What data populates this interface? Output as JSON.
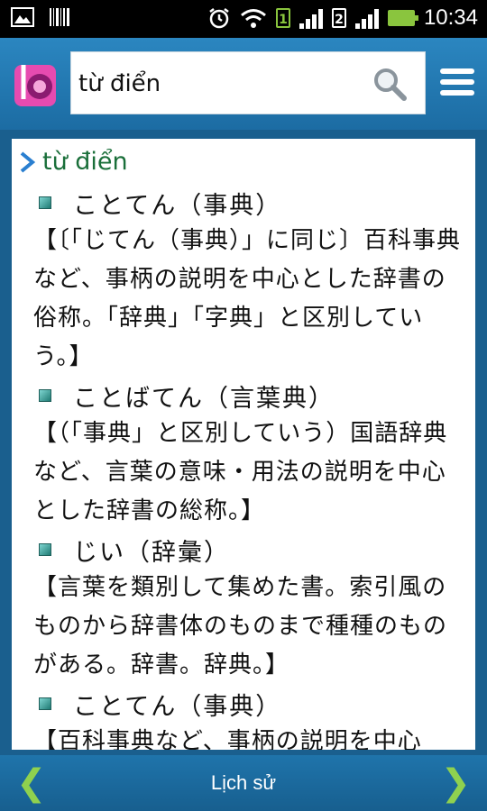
{
  "status_bar": {
    "time": "10:34",
    "sim1": "1",
    "sim2": "2"
  },
  "search": {
    "value": "từ điển"
  },
  "result": {
    "query": "từ điển",
    "entries": [
      {
        "headword": "ことてん（事典）",
        "definition": "【〔「じてん（事典）」に同じ〕百科事典など、事柄の説明を中心とした辞書の俗称。「辞典」「字典」と区別していう。】"
      },
      {
        "headword": "ことばてん（言葉典）",
        "definition": "【（「事典」と区別していう）国語辞典など、言葉の意味・用法の説明を中心とした辞書の総称。】"
      },
      {
        "headword": "じい（辞彙）",
        "definition": "【言葉を類別して集めた書。索引風のものから辞書体のものまで種種のものがある。辞書。辞典。】"
      },
      {
        "headword": "ことてん（事典）",
        "definition": "【百科事典など、事柄の説明を中心"
      }
    ]
  },
  "bottom_bar": {
    "prev": "❮",
    "history": "Lịch sử",
    "next": "❯"
  },
  "colors": {
    "header": "#2b86c0",
    "accent_green": "#8fd14f",
    "query_text": "#1a6f3a"
  }
}
